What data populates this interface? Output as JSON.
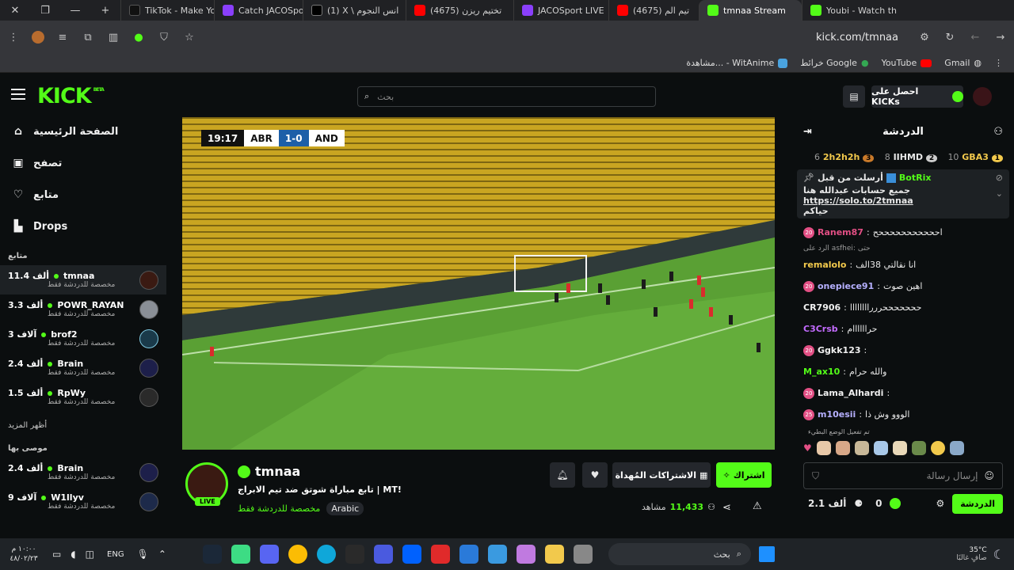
{
  "browser": {
    "tabs": [
      {
        "title": "TikTok - Make Yo",
        "color": "#111111"
      },
      {
        "title": "Catch JACOSport",
        "color": "#8a3ffc"
      },
      {
        "title": "(1) X \\ انس النجوم",
        "color": "#000000"
      },
      {
        "title": "(4675) تختيم ريزن",
        "color": "#ff0000"
      },
      {
        "title": "JACOSport LIVE",
        "color": "#8a3ffc"
      },
      {
        "title": "(4675) تيم الم",
        "color": "#ff0000"
      },
      {
        "title": "tmnaa Stream",
        "color": "#53fc18"
      },
      {
        "title": "Youbi - Watch th",
        "color": "#53fc18"
      }
    ],
    "url": "kick.com/tmnaa",
    "bookmarks": [
      "Gmail",
      "YouTube",
      "خرائط Google",
      "مشاهدة... - WitAnime"
    ]
  },
  "header": {
    "logo": "KICK",
    "logo_beta": "BETA",
    "search_placeholder": "بحث",
    "get_kicks": "احصل على KICKs"
  },
  "sidebar": {
    "nav": [
      {
        "label": "الصفحة الرئيسية",
        "icon": "home-icon"
      },
      {
        "label": "تصفح",
        "icon": "browse-icon"
      },
      {
        "label": "متابع",
        "icon": "heart-icon"
      },
      {
        "label": "Drops",
        "icon": "drops-icon"
      }
    ],
    "following_title": "متابع",
    "following": [
      {
        "name": "tmnaa",
        "viewers": "11.4 ألف",
        "sub": "مخصصة للدردشة فقط"
      },
      {
        "name": "POWR_RAYAN",
        "viewers": "3.3 ألف",
        "sub": "مخصصة للدردشة فقط"
      },
      {
        "name": "brof2",
        "viewers": "3 آلاف",
        "sub": "مخصصة للدردشة فقط"
      },
      {
        "name": "Brain",
        "viewers": "2.4 ألف",
        "sub": "مخصصة للدردشة فقط"
      },
      {
        "name": "RpWy",
        "viewers": "1.5 ألف",
        "sub": "مخصصة للدردشة فقط"
      }
    ],
    "show_more": "أظهر المزيد",
    "recommended_title": "موصى بها",
    "recommended": [
      {
        "name": "Brain",
        "viewers": "2.4 ألف",
        "sub": "مخصصة للدردشة فقط"
      },
      {
        "name": "W1llyv",
        "viewers": "9 آلاف",
        "sub": "مخصصة للدردشة فقط"
      }
    ]
  },
  "player": {
    "clock": "19:17",
    "home": "ABR",
    "score": "1-0",
    "away": "AND"
  },
  "stream": {
    "channel": "tmnaa",
    "title": "تابع مباراة شوتق ضد تيم الابراج | MT!",
    "category": "مخصصة للدردشة فقط",
    "language": "Arabic",
    "live_label": "LIVE",
    "viewers": "11,433",
    "viewers_label": "مشاهد",
    "subscribe": "اشتراك",
    "gifted": "الاشتراكات المُهداة"
  },
  "chat": {
    "title": "الدردشة",
    "leaders": [
      {
        "name": "2h2h2h",
        "count": "6",
        "rank": "3"
      },
      {
        "name": "IIHMD",
        "count": "8",
        "rank": "2"
      },
      {
        "name": "GBA3",
        "count": "10",
        "rank": "1"
      }
    ],
    "pinned": {
      "author": "BotRix",
      "label": "أرسلت من قبل",
      "link": "https://solo.to/2tmnaa",
      "text": "جميع حسابات عبدالله هنا",
      "text2": "حياكم"
    },
    "messages": [
      {
        "user": "Ranem87",
        "text": "احححححححححححح",
        "color": "#e24f84",
        "badge": "20"
      },
      {
        "user": "remalolo",
        "text": "انا نقالتي 38الف",
        "color": "#f2c94c",
        "reply": "الرد على asfhei: حتى"
      },
      {
        "user": "onepiece91",
        "text": "اهين صوت",
        "color": "#b6b0ff",
        "badge": "20"
      },
      {
        "user": "CR7906",
        "text": "حححححححررراااااااا",
        "color": "#f0f0f0"
      },
      {
        "user": "C3Crsb",
        "text": "حراااااام",
        "color": "#c36bff"
      },
      {
        "user": "Ggkk123",
        "text": "",
        "color": "#f0f0f0",
        "badge": "20"
      },
      {
        "user": "M_ax10",
        "text": "والله حرام",
        "color": "#53fc18"
      },
      {
        "user": "Lama_Alhardi",
        "text": "",
        "color": "#f0f0f0",
        "badge": "20"
      },
      {
        "user": "m10esii",
        "text": "الووو وش ذا",
        "color": "#b6b0ff",
        "badge": "25"
      }
    ],
    "slow_mode": "تم تفعيل الوضع البطيء",
    "input_placeholder": "إرسال رسالة",
    "send": "الدردشة",
    "kicks": "0",
    "points": "2.1 ألف"
  },
  "taskbar": {
    "search": "بحث",
    "lang": "ENG",
    "time": "١٠:٠٠ م",
    "date": "٤٨/٠٢/٢٣",
    "weather_temp": "35°C",
    "weather_text": "صافٍ غالبًا"
  }
}
